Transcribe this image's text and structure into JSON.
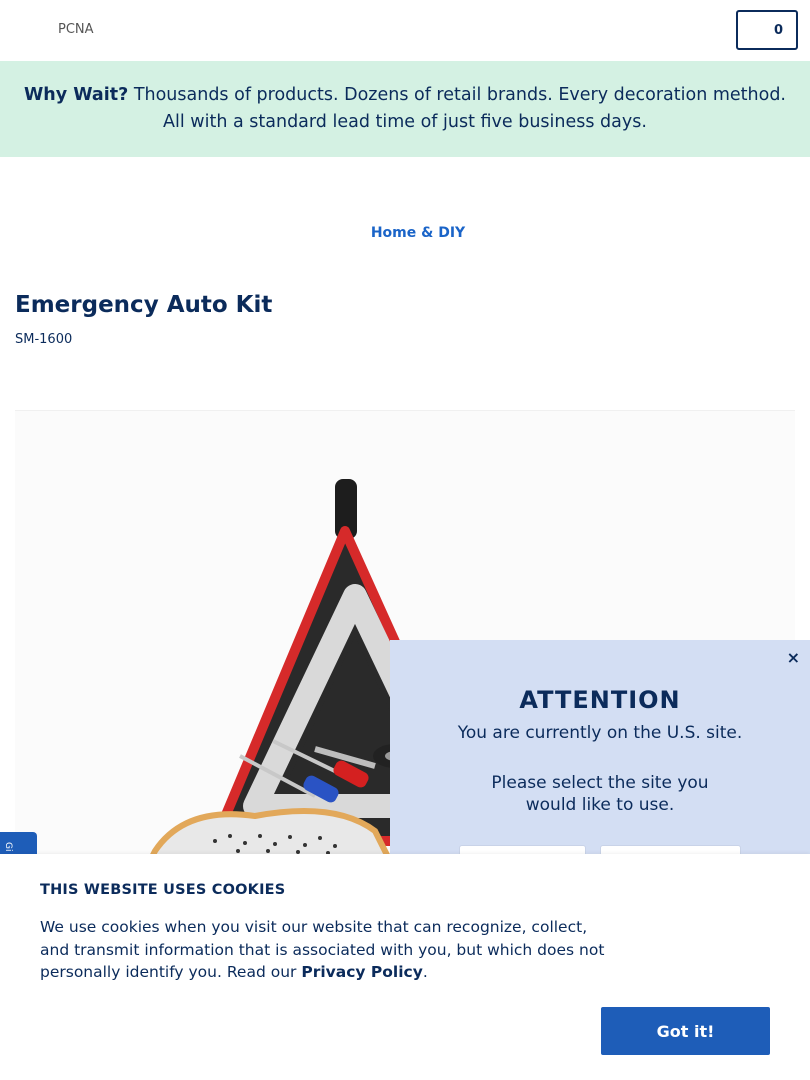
{
  "header": {
    "logo_alt": "PCNA",
    "cart_count": "0"
  },
  "promo": {
    "lead": "Why Wait?",
    "text": " Thousands of products. Dozens of retail brands. Every decoration method. All with a standard lead time of just five business days."
  },
  "breadcrumb": {
    "category": "Home & DIY"
  },
  "product": {
    "title": "Emergency Auto Kit",
    "sku": "SM-1600"
  },
  "side_tab": {
    "label": "Gi"
  },
  "attention": {
    "close": "×",
    "title": "ATTENTION",
    "site_msg": "You are currently on the U.S. site.",
    "select_msg": "Please select the site you would like to use."
  },
  "cookie": {
    "title": "THIS WEBSITE USES COOKIES",
    "body": "We use cookies when you visit our website that can recognize, collect, and transmit information that is associated with you, but which does not personally identify you. Read our ",
    "link": "Privacy Policy",
    "tail": ".",
    "button": "Got it!"
  },
  "colors": {
    "navy": "#0b2b5b",
    "accent_blue": "#1e5db8",
    "promo_bg": "#d4f1e3",
    "attention_bg": "#d3def3"
  }
}
